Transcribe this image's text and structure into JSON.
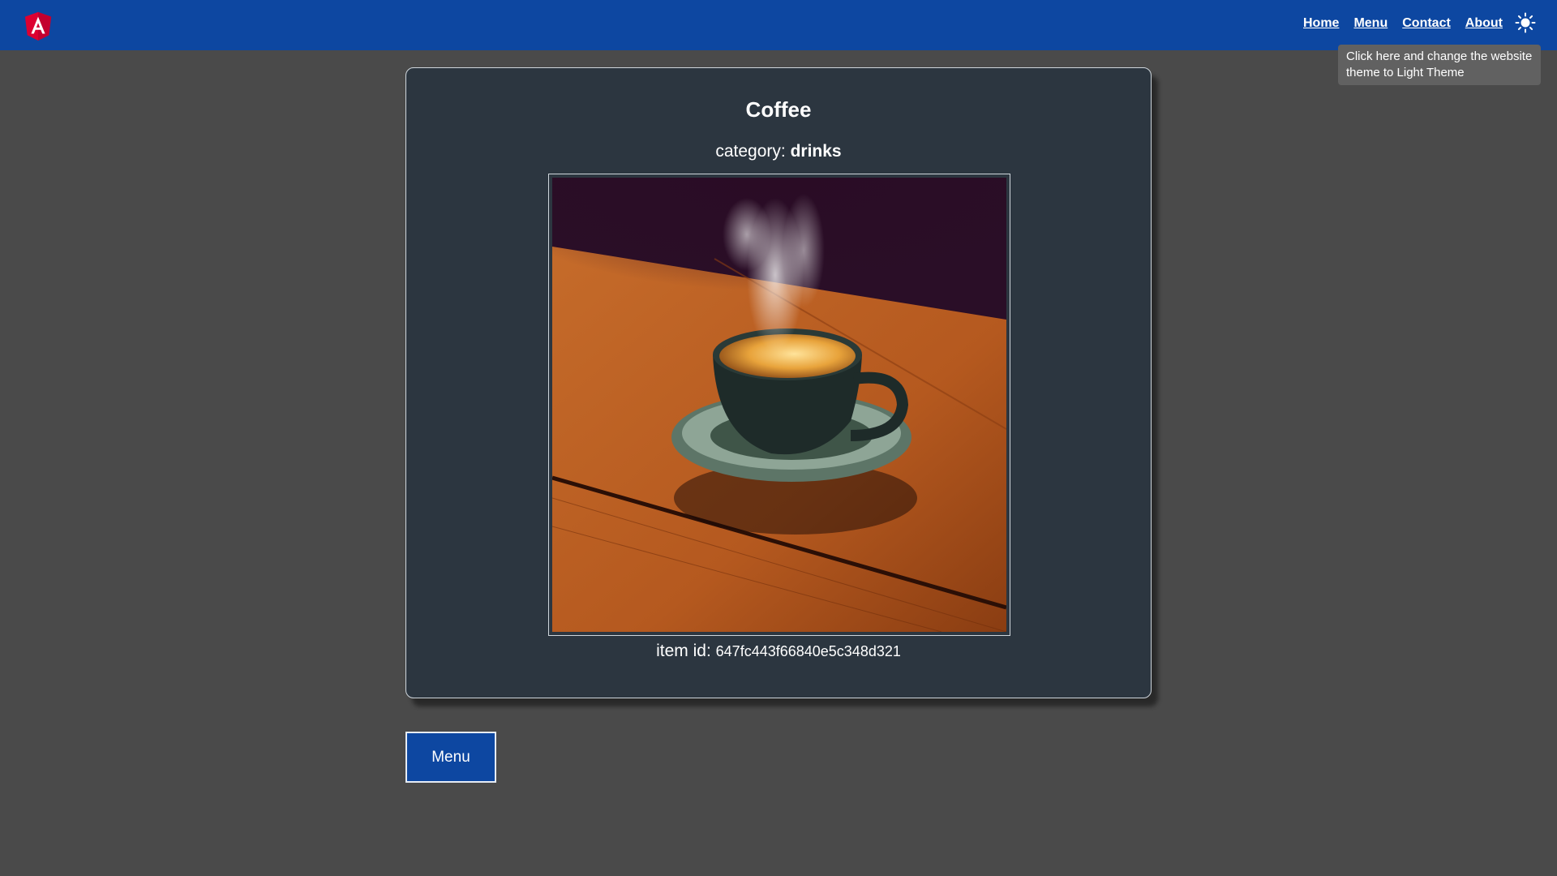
{
  "header": {
    "logo_name": "angular-logo",
    "nav": [
      {
        "label": "Home"
      },
      {
        "label": "Menu"
      },
      {
        "label": "Contact"
      },
      {
        "label": "About"
      }
    ],
    "theme_icon": "sun-icon",
    "tooltip": "Click here and change the website theme to Light Theme"
  },
  "item": {
    "title": "Coffee",
    "category_label": "category:",
    "category_value": "drinks",
    "image_alt": "coffee cup on wooden table",
    "id_label": "item id:",
    "id_value": "647fc443f66840e5c348d321"
  },
  "actions": {
    "menu_label": "Menu"
  },
  "colors": {
    "header": "#0d47a1",
    "background": "#4a4a4a",
    "card": "#2c3640",
    "tooltip": "#616161"
  }
}
